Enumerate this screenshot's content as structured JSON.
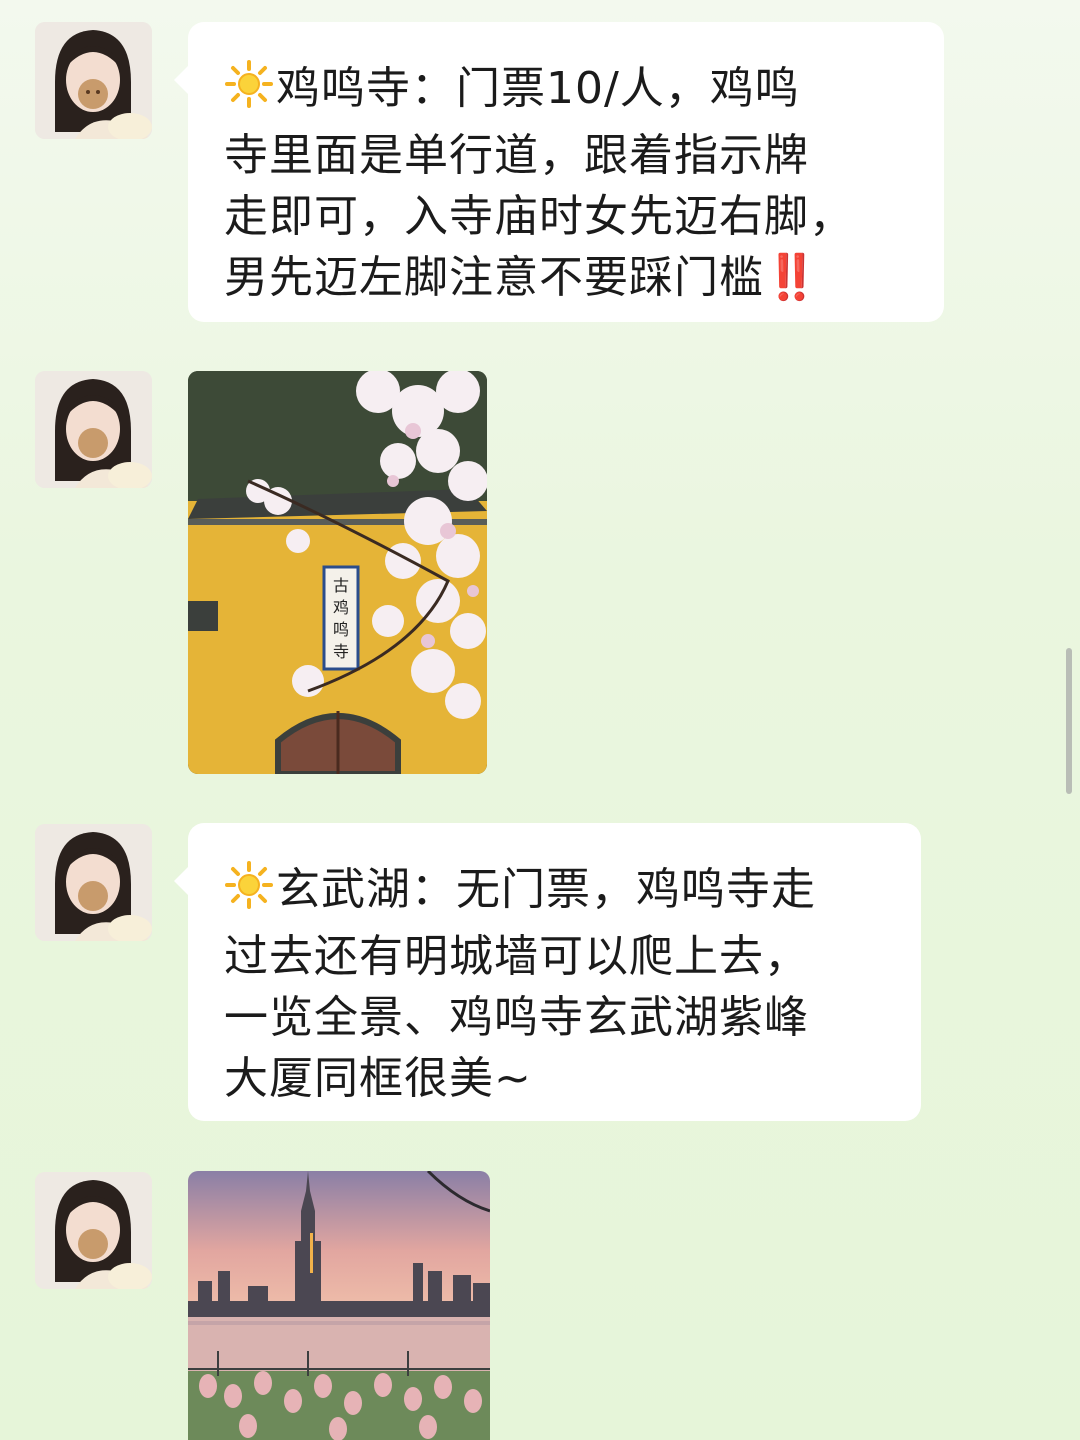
{
  "messages": [
    {
      "type": "text",
      "emoji": "sun-icon",
      "lines": [
        "鸡鸣寺：门票10/人，鸡鸣",
        "寺里面是单行道，跟着指示牌",
        "走即可，入寺庙时女先迈右脚，",
        "男先迈左脚注意不要踩门槛"
      ],
      "trailing": "‼️"
    },
    {
      "type": "image",
      "alt_icon": "temple-photo",
      "sign_text": "古鸡鸣寺"
    },
    {
      "type": "text",
      "emoji": "sun-icon",
      "lines": [
        "玄武湖：无门票，鸡鸣寺走",
        "过去还有明城墙可以爬上去，",
        "一览全景、鸡鸣寺玄武湖紫峰",
        "大厦同框很美~"
      ],
      "trailing": ""
    },
    {
      "type": "image",
      "alt_icon": "lake-skyline-photo"
    }
  ],
  "colors": {
    "bubble": "#ffffff",
    "background": "#eaf6df",
    "accent_warning": "#e2352b"
  }
}
